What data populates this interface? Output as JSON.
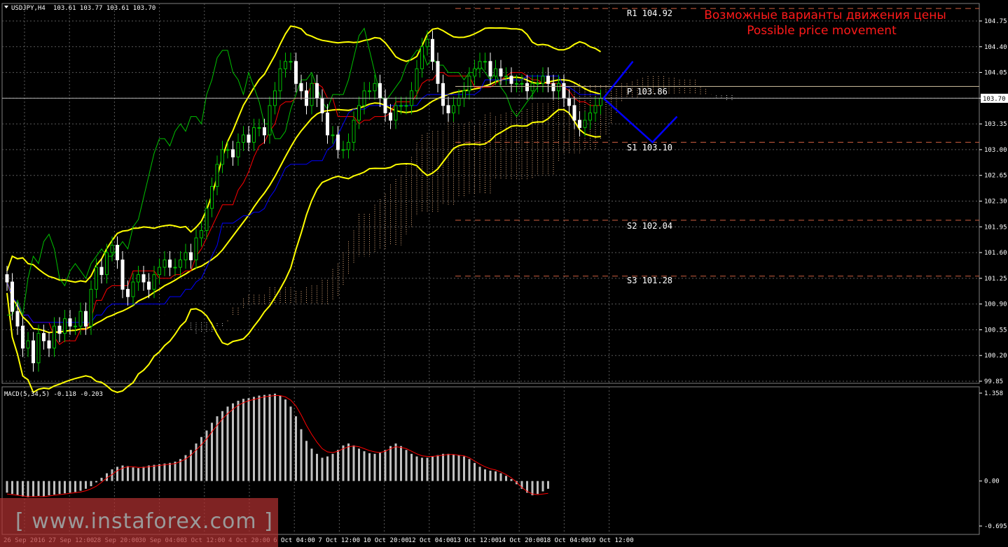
{
  "header": {
    "symbol": "USDJPY,H4",
    "ohlc": "103.61 103.77 103.61 103.70"
  },
  "annotation": {
    "line1": "Возможные варианты движения цены",
    "line2": "Possible price movement"
  },
  "levels": [
    {
      "label": "R1 104.92",
      "value": 104.92
    },
    {
      "label": "P 103.86",
      "value": 103.86
    },
    {
      "label": "S1 103.10",
      "value": 103.1
    },
    {
      "label": "S2 102.04",
      "value": 102.04
    },
    {
      "label": "S3 101.28",
      "value": 101.28
    }
  ],
  "current_price": "103.70",
  "watermark": "[ www.instaforex.com ]",
  "colors": {
    "background": "#000000",
    "grid": "#5a5a5a",
    "bull_candle": "#00c000",
    "bear_candle": "#ffffff",
    "bollinger": "#ffff00",
    "tenkan": "#ff0000",
    "kijun": "#0000ff",
    "chikou": "#00c000",
    "macd_hist": "#c0c0c0",
    "macd_signal": "#ff0000",
    "projection": "#0000ff",
    "annotation": "#ff1a1a",
    "watermark_bg": "#b03030"
  },
  "chart_data": [
    {
      "type": "candlestick",
      "title": "USDJPY,H4",
      "ylim": [
        99.85,
        104.75
      ],
      "y_ticks": [
        "104.75",
        "104.40",
        "104.05",
        "103.70",
        "103.35",
        "103.00",
        "102.65",
        "102.30",
        "101.95",
        "101.60",
        "101.25",
        "100.90",
        "100.55",
        "100.20",
        "99.85"
      ],
      "x_ticks": [
        "26 Sep 2016",
        "27 Sep 12:00",
        "28 Sep 20:00",
        "30 Sep 04:00",
        "3 Oct 12:00",
        "4 Oct 20:00",
        "6 Oct 04:00",
        "7 Oct 12:00",
        "10 Oct 20:00",
        "12 Oct 04:00",
        "13 Oct 12:00",
        "14 Oct 20:00",
        "18 Oct 04:00",
        "19 Oct 12:00"
      ],
      "indicators": [
        "Bollinger Bands",
        "Ichimoku Kinko Hyo"
      ],
      "grid": true,
      "closes": [
        101.2,
        100.8,
        100.6,
        100.3,
        100.4,
        100.1,
        100.5,
        100.4,
        100.3,
        100.6,
        100.5,
        100.7,
        100.6,
        100.6,
        100.8,
        100.6,
        101.1,
        101.4,
        101.3,
        101.6,
        101.7,
        101.5,
        101.1,
        101.0,
        101.2,
        101.3,
        101.2,
        101.1,
        101.3,
        101.4,
        101.5,
        101.4,
        101.4,
        101.5,
        101.6,
        101.5,
        101.8,
        101.9,
        102.2,
        102.5,
        102.8,
        103.0,
        103.0,
        102.9,
        103.1,
        103.2,
        103.1,
        103.3,
        103.3,
        103.2,
        103.6,
        103.8,
        104.1,
        104.2,
        104.2,
        103.9,
        103.8,
        103.6,
        103.9,
        103.7,
        103.5,
        103.2,
        103.2,
        103.0,
        103.0,
        103.1,
        103.4,
        103.6,
        103.8,
        103.8,
        103.9,
        103.7,
        103.5,
        103.4,
        103.6,
        103.6,
        103.6,
        103.8,
        104.1,
        104.4,
        104.5,
        104.2,
        103.9,
        103.6,
        103.5,
        103.6,
        103.7,
        103.8,
        104.0,
        104.1,
        104.2,
        104.2,
        104.0,
        104.1,
        104.0,
        104.0,
        103.9,
        103.9,
        103.9,
        103.8,
        103.9,
        103.9,
        104.0,
        103.9,
        103.8,
        103.9,
        103.7,
        103.6,
        103.4,
        103.3,
        103.4,
        103.5,
        103.6,
        103.7
      ],
      "projection": [
        {
          "label": "up",
          "points": [
            [
              103.7,
              0
            ],
            [
              104.2,
              12
            ]
          ]
        },
        {
          "label": "down",
          "points": [
            [
              103.7,
              0
            ],
            [
              103.1,
              20
            ],
            [
              103.45,
              30
            ]
          ]
        }
      ]
    },
    {
      "type": "bar",
      "title": "MACD(5,34,5) -0.118 -0.203",
      "ylim": [
        -0.695,
        1.358
      ],
      "y_ticks": [
        "1.358",
        "0.00",
        "-0.695"
      ],
      "histogram": [
        -0.18,
        -0.2,
        -0.22,
        -0.24,
        -0.25,
        -0.24,
        -0.23,
        -0.24,
        -0.22,
        -0.21,
        -0.2,
        -0.19,
        -0.18,
        -0.17,
        -0.15,
        -0.12,
        -0.08,
        -0.02,
        0.05,
        0.12,
        0.18,
        0.22,
        0.24,
        0.23,
        0.21,
        0.2,
        0.22,
        0.24,
        0.25,
        0.26,
        0.27,
        0.28,
        0.3,
        0.34,
        0.4,
        0.48,
        0.58,
        0.68,
        0.78,
        0.9,
        1.0,
        1.08,
        1.15,
        1.2,
        1.24,
        1.27,
        1.28,
        1.3,
        1.32,
        1.33,
        1.34,
        1.35,
        1.32,
        1.26,
        1.15,
        1.0,
        0.8,
        0.62,
        0.5,
        0.42,
        0.36,
        0.38,
        0.42,
        0.48,
        0.55,
        0.58,
        0.55,
        0.5,
        0.46,
        0.43,
        0.42,
        0.44,
        0.48,
        0.54,
        0.58,
        0.54,
        0.48,
        0.42,
        0.38,
        0.36,
        0.36,
        0.38,
        0.4,
        0.42,
        0.42,
        0.41,
        0.4,
        0.38,
        0.34,
        0.28,
        0.22,
        0.18,
        0.16,
        0.15,
        0.12,
        0.08,
        0.03,
        -0.05,
        -0.12,
        -0.18,
        -0.22,
        -0.2,
        -0.16,
        -0.12
      ],
      "signal": [
        -0.2,
        -0.21,
        -0.22,
        -0.23,
        -0.24,
        -0.24,
        -0.24,
        -0.24,
        -0.23,
        -0.22,
        -0.21,
        -0.2,
        -0.19,
        -0.18,
        -0.17,
        -0.15,
        -0.12,
        -0.08,
        -0.02,
        0.05,
        0.1,
        0.16,
        0.2,
        0.22,
        0.22,
        0.21,
        0.21,
        0.22,
        0.23,
        0.24,
        0.25,
        0.26,
        0.27,
        0.3,
        0.34,
        0.4,
        0.48,
        0.56,
        0.65,
        0.76,
        0.86,
        0.96,
        1.04,
        1.11,
        1.17,
        1.21,
        1.24,
        1.26,
        1.28,
        1.3,
        1.31,
        1.32,
        1.32,
        1.3,
        1.25,
        1.16,
        1.02,
        0.86,
        0.72,
        0.6,
        0.5,
        0.45,
        0.44,
        0.46,
        0.5,
        0.53,
        0.54,
        0.53,
        0.5,
        0.47,
        0.45,
        0.44,
        0.46,
        0.5,
        0.53,
        0.52,
        0.5,
        0.46,
        0.42,
        0.39,
        0.38,
        0.38,
        0.39,
        0.4,
        0.41,
        0.41,
        0.4,
        0.39,
        0.36,
        0.31,
        0.26,
        0.22,
        0.19,
        0.17,
        0.14,
        0.1,
        0.05,
        -0.02,
        -0.1,
        -0.16,
        -0.2,
        -0.21,
        -0.2,
        -0.19
      ]
    }
  ]
}
